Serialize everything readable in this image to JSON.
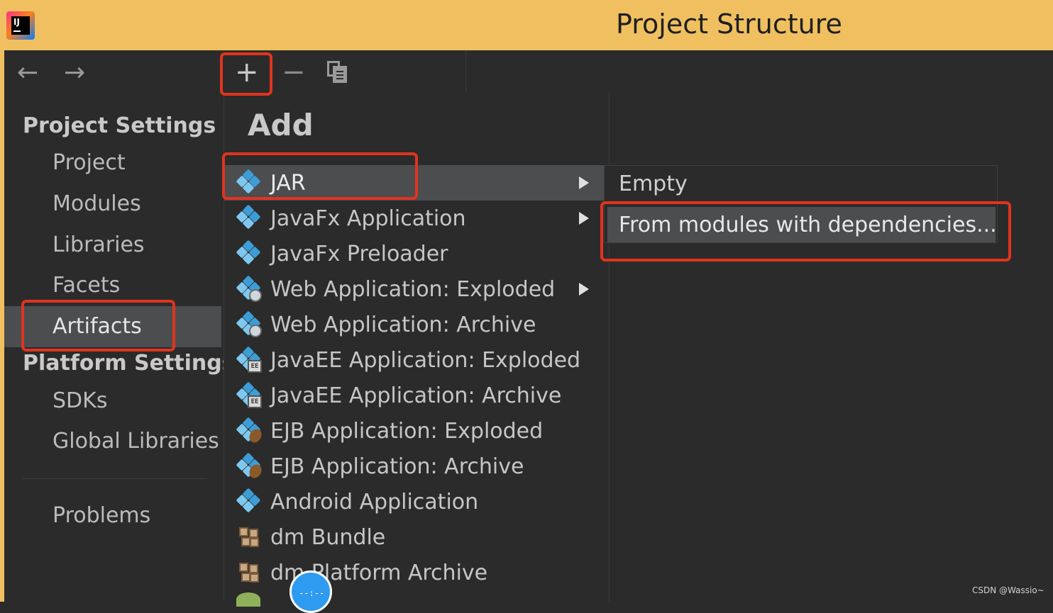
{
  "window": {
    "title": "Project Structure"
  },
  "app_logo": {
    "text": "IJ"
  },
  "nav": {
    "back": "←",
    "forward": "→"
  },
  "toolbar": {
    "add": "+",
    "remove": "−"
  },
  "sidebar": {
    "project_settings_title": "Project Settings",
    "project_items": [
      "Project",
      "Modules",
      "Libraries",
      "Facets",
      "Artifacts"
    ],
    "selected": "Artifacts",
    "platform_settings_title": "Platform Settings",
    "platform_items": [
      "SDKs",
      "Global Libraries"
    ],
    "problems": "Problems"
  },
  "add_menu": {
    "title": "Add",
    "items": [
      {
        "label": "JAR",
        "icon": "jar-icon",
        "submenu": true
      },
      {
        "label": "JavaFx Application",
        "icon": "javafx-app-icon",
        "submenu": true
      },
      {
        "label": "JavaFx Preloader",
        "icon": "javafx-preloader-icon",
        "submenu": false
      },
      {
        "label": "Web Application: Exploded",
        "icon": "web-app-icon",
        "submenu": true
      },
      {
        "label": "Web Application: Archive",
        "icon": "web-app-icon",
        "submenu": false
      },
      {
        "label": "JavaEE Application: Exploded",
        "icon": "javaee-app-icon",
        "submenu": false
      },
      {
        "label": "JavaEE Application: Archive",
        "icon": "javaee-app-icon",
        "submenu": false
      },
      {
        "label": "EJB Application: Exploded",
        "icon": "ejb-app-icon",
        "submenu": false
      },
      {
        "label": "EJB Application: Archive",
        "icon": "ejb-app-icon",
        "submenu": false
      },
      {
        "label": "Android Application",
        "icon": "android-app-icon",
        "submenu": false
      },
      {
        "label": "dm Bundle",
        "icon": "dm-bundle-icon",
        "submenu": false
      },
      {
        "label": "dm Platform Archive",
        "icon": "dm-platform-icon",
        "submenu": false
      }
    ]
  },
  "jar_submenu": {
    "items": [
      "Empty",
      "From modules with dependencies..."
    ],
    "selected": "From modules with dependencies..."
  },
  "overlay": {
    "bubble_text": "--:--"
  },
  "watermark": "CSDN @Wassio~",
  "colors": {
    "titlebar": "#f0c060",
    "background": "#2b2b2b",
    "selection": "#4b4d4f",
    "highlight": "#e0341f",
    "artifact_icon": "#3d9dd6"
  }
}
